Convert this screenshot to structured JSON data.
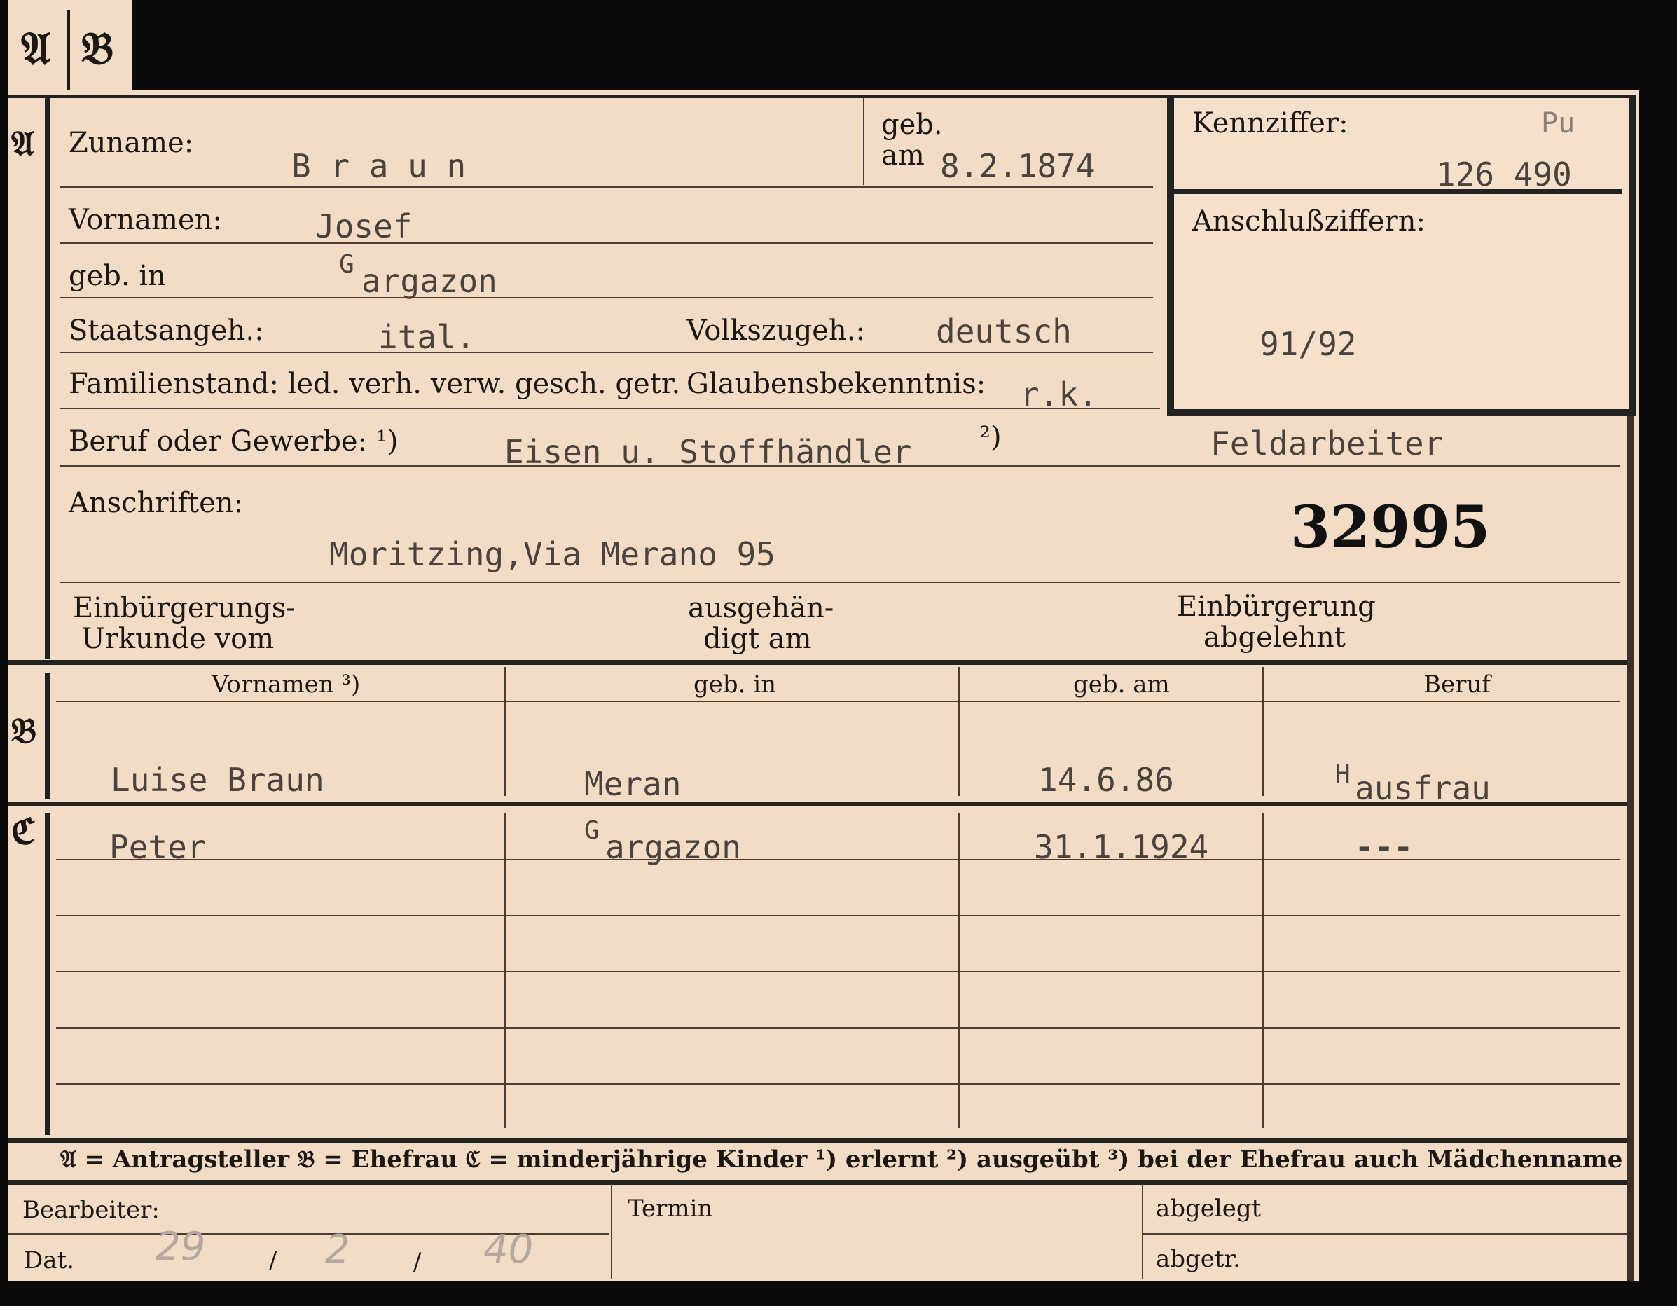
{
  "tabs": [
    "𝔄",
    "𝔅"
  ],
  "sections": {
    "a": "𝔄",
    "b": "𝔅",
    "c": "ℭ"
  },
  "applicant": {
    "surname_label": "Zuname:",
    "surname": "B r a u n",
    "born_on_label_1": "geb.",
    "born_on_label_2": "am",
    "born_on": "8.2.1874",
    "firstnames_label": "Vornamen:",
    "firstnames": "Josef",
    "born_in_label": "geb. in",
    "born_in_initial": "G",
    "born_in_rest": "argazon",
    "citizenship_label": "Staatsangeh.:",
    "citizenship": "ital.",
    "ethnicity_label": "Volkszugeh.:",
    "ethnicity": "deutsch",
    "family_status_label": "Familienstand: led. verh. verw. gesch. getr.",
    "religion_label": "Glaubensbekenntnis:",
    "religion": "r.k.",
    "occupation_label": "Beruf oder Gewerbe: ¹)",
    "occupation_learned": "Eisen u. Stoffhändler",
    "occupation_mark": "²)",
    "occupation_practiced": "Feldarbeiter",
    "addresses_label": "Anschriften:",
    "address": "Moritzing,Via Merano 95",
    "file_number": "32995",
    "naturalization_label_1": "Einbürgerungs-",
    "naturalization_label_2": "Urkunde vom",
    "handed_label_1": "ausgehän-",
    "handed_label_2": "digt am",
    "rejected_label_1": "Einbürgerung",
    "rejected_label_2": "abgelehnt"
  },
  "id_box": {
    "id_label": "Kennziffer:",
    "id_prefix": "Pu",
    "id_number": "126 490",
    "link_label": "Anschlußziffern:",
    "link_number": "91/92"
  },
  "family_table": {
    "headers": [
      "Vornamen ³)",
      "geb. in",
      "geb. am",
      "Beruf"
    ],
    "spouse": {
      "firstnames": "Luise Braun",
      "born_in": "Meran",
      "born_on": "14.6.86",
      "occupation_initial": "H",
      "occupation_rest": "ausfrau"
    },
    "children": [
      {
        "firstnames": "Peter",
        "born_in_initial": "G",
        "born_in_rest": "argazon",
        "born_on": "31.1.1924",
        "occupation": "---"
      }
    ]
  },
  "legend": "𝔄 = Antragsteller   𝔅 = Ehefrau   ℭ = minderjährige Kinder   ¹) erlernt   ²) ausgeübt   ³) bei der Ehefrau auch Mädchenname",
  "footer": {
    "clerk_label": "Bearbeiter:",
    "date_label": "Dat.",
    "date_day": "29",
    "date_month": "2",
    "date_year": "40",
    "date_sep": "/",
    "deadline_label": "Termin",
    "filed_label": "abgelegt",
    "separated_label": "abgetr."
  }
}
